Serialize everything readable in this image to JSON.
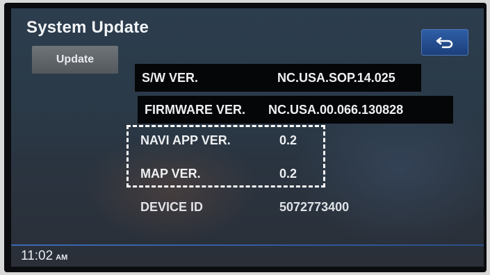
{
  "screen": {
    "title": "System Update",
    "back_icon": "back-arrow-icon"
  },
  "sidebar": {
    "update_label": "Update"
  },
  "info": {
    "sw_version": {
      "label": "S/W VER.",
      "value": "NC.USA.SOP.14.025"
    },
    "firmware_version": {
      "label": "FIRMWARE VER.",
      "value": "NC.USA.00.066.130828"
    },
    "navi_app_version": {
      "label": "NAVI APP VER.",
      "value": "0.2"
    },
    "map_version": {
      "label": "MAP VER.",
      "value": "0.2"
    },
    "device_id": {
      "label": "DEVICE ID",
      "value": "5072773400"
    }
  },
  "status_bar": {
    "time": "11:02",
    "ampm": "AM"
  },
  "colors": {
    "accent": "#2e5ea6",
    "highlight_dash": "#ffffff"
  }
}
